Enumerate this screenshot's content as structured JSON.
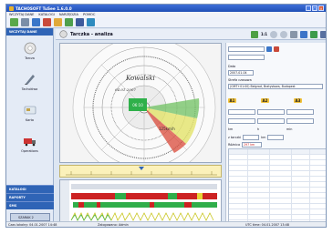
{
  "window": {
    "title": "TACHOSOFT TuSee 1.6.0.0"
  },
  "menu": [
    "WCZYTAJ DANE",
    "KATALOGI",
    "NARZĘDZIA",
    "POMOC"
  ],
  "sidebar": {
    "header": "WCZYTAJ DANE",
    "items": [
      {
        "label": "Tarcza",
        "icon": "chart-disc-icon"
      },
      {
        "label": "Tachokiwa",
        "icon": "pen-icon"
      },
      {
        "label": "Karta",
        "icon": "card-icon"
      },
      {
        "label": "Operations",
        "icon": "truck-icon"
      }
    ],
    "sections": [
      "KATALOGI",
      "RAPORTY",
      "SMS"
    ],
    "active": "SZARAK 2"
  },
  "main": {
    "tab_title": "Tarczka - analiza",
    "zoom_label": "1:1"
  },
  "chart": {
    "disc_text": "Kowalski",
    "speed_label": "125km/h",
    "date": "04.01.2007"
  },
  "right": {
    "label_date": "Data",
    "date_value": "2007-01-04",
    "label_zone": "Strefa czasowa",
    "zone_value": "(GMT+01:00) Belgrad, Bratysława, Budapest",
    "groups": [
      "A1",
      "A2",
      "A3"
    ],
    "col1": "km",
    "col2": "h",
    "col3": "min",
    "row_label1": "z tarczki",
    "row_label2": "Różnica",
    "diff_value": "297 km",
    "row_unit": "km"
  },
  "status": {
    "left": "Czas lokalny: 04.01.2007   14:48",
    "middle": "Zalogowano: Admin",
    "right": "UTC time: 04.01.2007   13:48"
  },
  "colors": {
    "accent": "#2f64b6",
    "title": "#1f4fb6"
  }
}
